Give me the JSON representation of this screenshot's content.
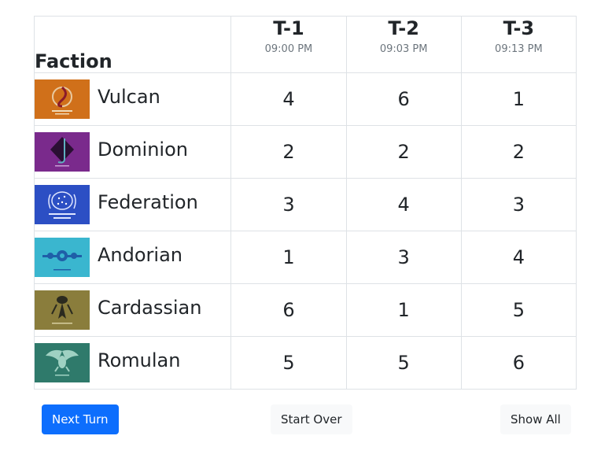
{
  "table": {
    "faction_header": "Faction",
    "turns": [
      {
        "label": "T-1",
        "time": "09:00 PM"
      },
      {
        "label": "T-2",
        "time": "09:03 PM"
      },
      {
        "label": "T-3",
        "time": "09:13 PM"
      }
    ],
    "rows": [
      {
        "name": "Vulcan",
        "scores": [
          "4",
          "6",
          "1"
        ],
        "emblem_color": "#d0701a"
      },
      {
        "name": "Dominion",
        "scores": [
          "2",
          "2",
          "2"
        ],
        "emblem_color": "#7a2a8c"
      },
      {
        "name": "Federation",
        "scores": [
          "3",
          "4",
          "3"
        ],
        "emblem_color": "#2c4fc4"
      },
      {
        "name": "Andorian",
        "scores": [
          "1",
          "3",
          "4"
        ],
        "emblem_color": "#3ab6cf"
      },
      {
        "name": "Cardassian",
        "scores": [
          "6",
          "1",
          "5"
        ],
        "emblem_color": "#8a7d3c"
      },
      {
        "name": "Romulan",
        "scores": [
          "5",
          "5",
          "6"
        ],
        "emblem_color": "#2f7a6b"
      }
    ]
  },
  "buttons": {
    "next_turn": "Next Turn",
    "start_over": "Start Over",
    "show_all": "Show All"
  },
  "colors": {
    "primary": "#0d6efd",
    "light_button": "#f8f9fa",
    "border": "#dee2e6",
    "muted_text": "#6c757d"
  }
}
